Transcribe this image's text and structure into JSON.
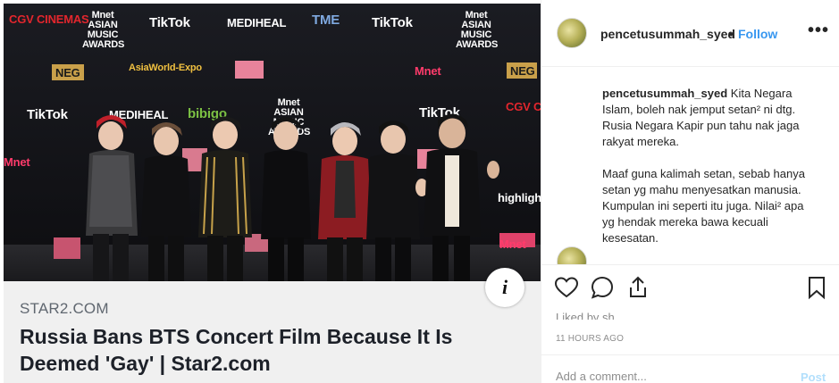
{
  "media": {
    "backdrop_logos": [
      "CGV CINEMAS",
      "Mnet ASIAN MUSIC AWARDS",
      "TikTok",
      "MEDIHEAL",
      "TME",
      "TikTok",
      "Mnet ASIAN MUSIC AWARDS",
      "NEG",
      "AsiaWorld-Expo",
      "Mnet",
      "NEG",
      "TikTok",
      "MEDIHEAL",
      "bibigo",
      "Mnet ASIAN MUSIC AWARDS",
      "TikTok",
      "CGV CINEMAS",
      "Mnet",
      "highlight",
      "Mnet"
    ],
    "info_glyph": "i",
    "link_preview": {
      "domain": "STAR2.COM",
      "headline": "Russia Bans BTS Concert Film Because It Is Deemed 'Gay' | Star2.com"
    }
  },
  "post": {
    "header": {
      "username": "pencetusummah_syed",
      "separator": "•",
      "follow_label": "Follow",
      "more_glyph": "•••"
    },
    "caption": {
      "username": "pencetusummah_syed",
      "paragraph1": "Kita Negara Islam, boleh nak jemput setan² ni dtg. Rusia Negara Kapir pun tahu nak jaga rakyat mereka.",
      "paragraph2": "Maaf guna kalimah setan, sebab hanya setan yg mahu menyesatkan manusia. Kumpulan ini seperti itu juga. Nilai² apa yg hendak mereka bawa kecuali kesesatan."
    },
    "actions": {
      "icons": [
        "heart-icon",
        "comment-icon",
        "share-icon",
        "bookmark-icon"
      ]
    },
    "liked_by_partial": "Liked by sh",
    "timestamp": "11 HOURS AGO",
    "add_comment": {
      "placeholder": "Add a comment...",
      "post_label": "Post"
    }
  },
  "colors": {
    "link_blue": "#3897f0",
    "post_disabled": "#b2dffc",
    "text": "#262626",
    "muted": "#8e8e8e",
    "headline": "#1d2129",
    "domain": "#606770"
  }
}
